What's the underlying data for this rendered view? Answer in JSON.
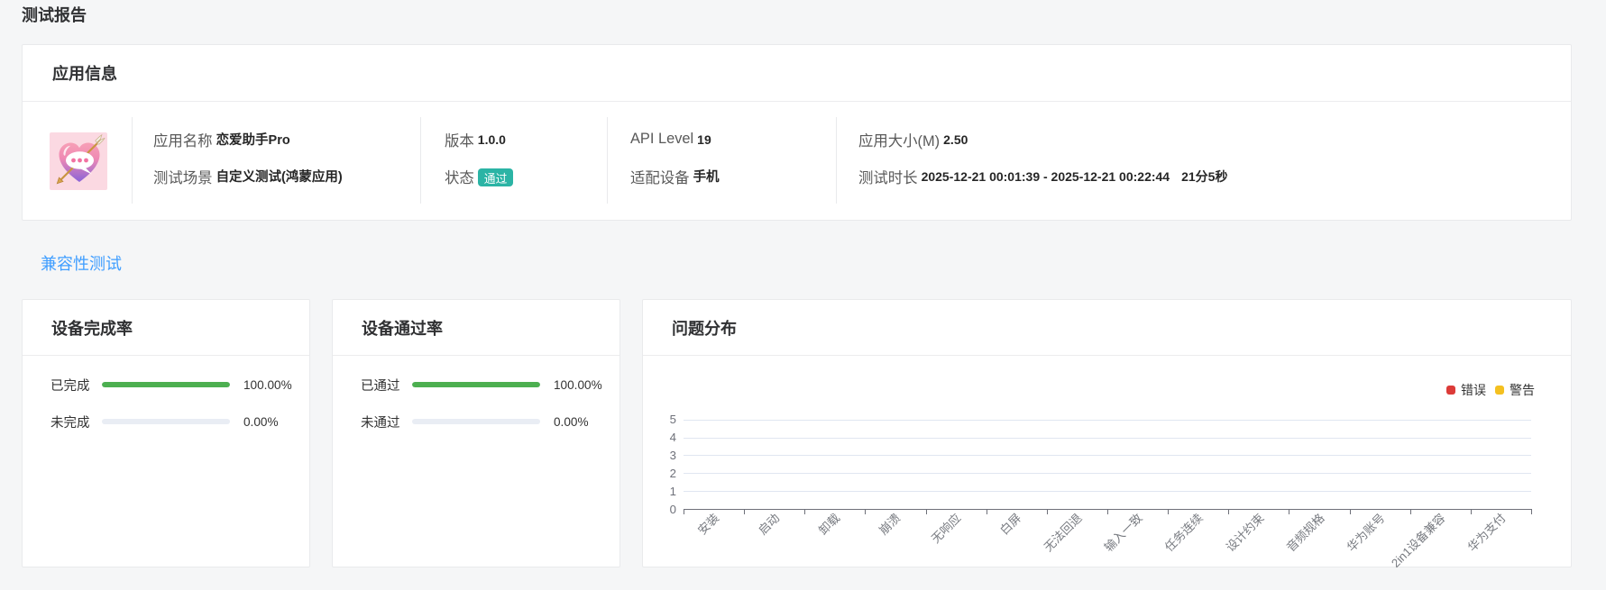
{
  "page": {
    "title": "测试报告"
  },
  "colors": {
    "accent_blue": "#409eff",
    "badge_teal": "#2bb4a5",
    "progress_green": "#4caf50",
    "progress_track": "#e9edf4",
    "error_red": "#dc3b38",
    "warning_yellow": "#f4c020"
  },
  "app_info": {
    "title": "应用信息",
    "icon": "love-chat-heart-app-icon",
    "fields": [
      {
        "label": "应用名称",
        "value": "恋爱助手Pro"
      },
      {
        "label": "测试场景",
        "value": "自定义测试(鸿蒙应用)"
      },
      {
        "label": "版本",
        "value": "1.0.0"
      },
      {
        "label": "状态",
        "value": "通过"
      },
      {
        "label": "API Level",
        "value": "19"
      },
      {
        "label": "适配设备",
        "value": "手机"
      },
      {
        "label": "应用大小(M)",
        "value": "2.50"
      },
      {
        "label": "测试时长",
        "value": "2025-12-21 00:01:39 - 2025-12-21 00:22:44",
        "extra": "21分5秒"
      }
    ]
  },
  "tab": {
    "label": "兼容性测试"
  },
  "completion_card": {
    "title": "设备完成率",
    "rows": [
      {
        "label": "已完成",
        "percent_text": "100.00%",
        "percent": 100
      },
      {
        "label": "未完成",
        "percent_text": "0.00%",
        "percent": 0
      }
    ]
  },
  "pass_card": {
    "title": "设备通过率",
    "rows": [
      {
        "label": "已通过",
        "percent_text": "100.00%",
        "percent": 100
      },
      {
        "label": "未通过",
        "percent_text": "0.00%",
        "percent": 0
      }
    ]
  },
  "issue_card": {
    "title": "问题分布"
  },
  "chart_data": {
    "type": "bar",
    "title": "问题分布",
    "categories": [
      "安装",
      "启动",
      "卸载",
      "崩溃",
      "无响应",
      "白屏",
      "无法回退",
      "输入一致",
      "任务连续",
      "设计约束",
      "音频规格",
      "华为账号",
      "2in1设备兼容",
      "华为支付"
    ],
    "series": [
      {
        "name": "错误",
        "color": "#dc3b38",
        "values": [
          0,
          0,
          0,
          0,
          0,
          0,
          0,
          0,
          0,
          0,
          0,
          0,
          0,
          0
        ]
      },
      {
        "name": "警告",
        "color": "#f4c020",
        "values": [
          0,
          0,
          0,
          0,
          0,
          0,
          0,
          0,
          0,
          0,
          0,
          0,
          0,
          0
        ]
      }
    ],
    "ylim": [
      0,
      5
    ],
    "yticks": [
      0,
      1,
      2,
      3,
      4,
      5
    ],
    "grid": true,
    "legend_position": "top-right"
  }
}
